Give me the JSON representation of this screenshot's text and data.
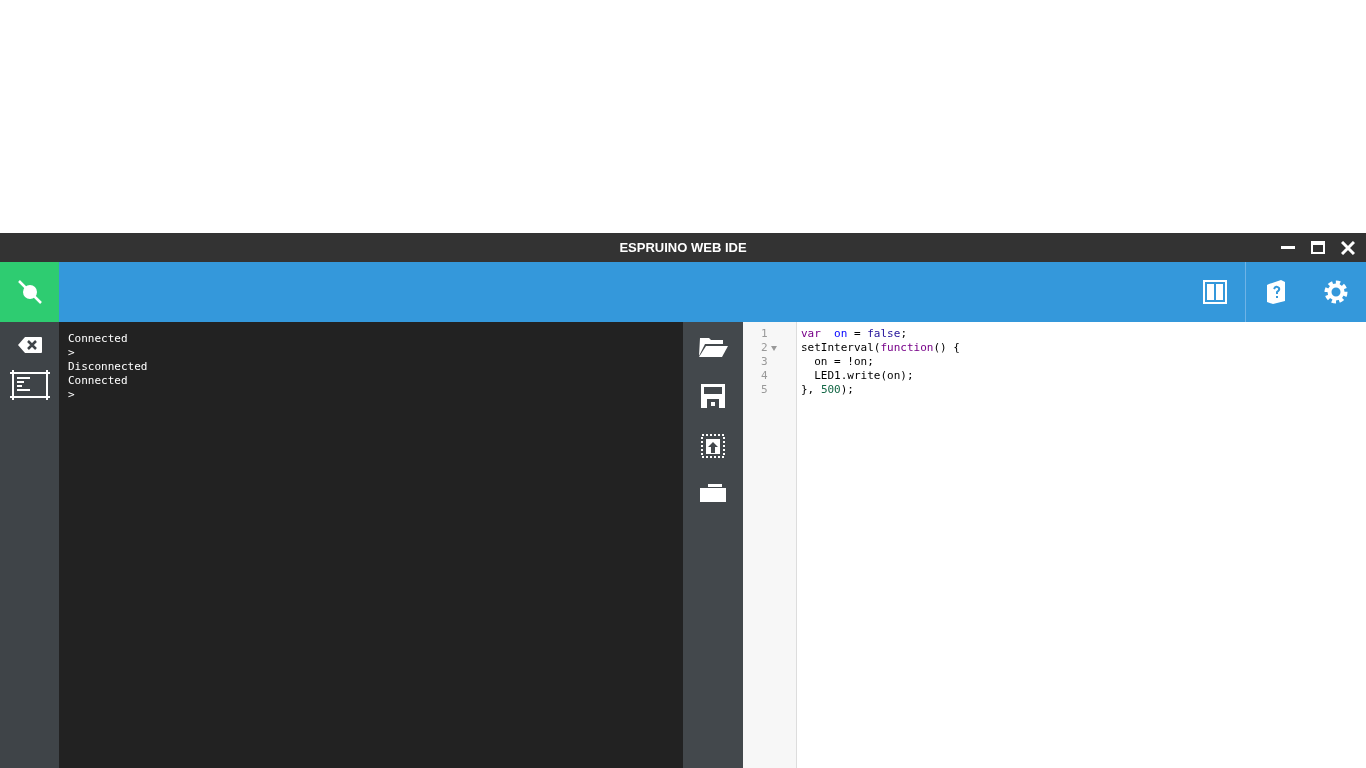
{
  "window": {
    "title": "ESPRUINO WEB IDE"
  },
  "toolbar": {
    "connected": true
  },
  "terminal": {
    "lines": [
      "Connected",
      ">",
      "Disconnected",
      "Connected",
      ">"
    ]
  },
  "editor": {
    "lines": [
      {
        "number": "1",
        "foldable": false,
        "tokens": [
          {
            "text": "var",
            "kind": "keyword"
          },
          {
            "text": "  on",
            "kind": "def"
          },
          {
            "text": " = ",
            "kind": "plain"
          },
          {
            "text": "false",
            "kind": "atom"
          },
          {
            "text": ";",
            "kind": "plain"
          }
        ]
      },
      {
        "number": "2",
        "foldable": true,
        "tokens": [
          {
            "text": "setInterval(",
            "kind": "plain"
          },
          {
            "text": "function",
            "kind": "keyword"
          },
          {
            "text": "() {",
            "kind": "plain"
          }
        ]
      },
      {
        "number": "3",
        "foldable": false,
        "tokens": [
          {
            "text": "  on = !on;",
            "kind": "plain"
          }
        ]
      },
      {
        "number": "4",
        "foldable": false,
        "tokens": [
          {
            "text": "  LED1.write(on);",
            "kind": "plain"
          }
        ]
      },
      {
        "number": "5",
        "foldable": false,
        "tokens": [
          {
            "text": "}, ",
            "kind": "plain"
          },
          {
            "text": "500",
            "kind": "number"
          },
          {
            "text": ");",
            "kind": "plain"
          }
        ]
      }
    ]
  }
}
